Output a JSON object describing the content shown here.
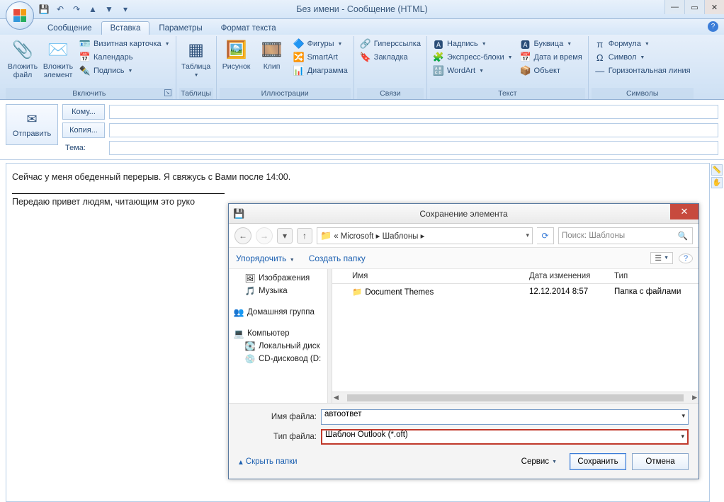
{
  "window": {
    "title": "Без имени - Сообщение (HTML)"
  },
  "qat": {
    "save": "💾",
    "undo": "↶",
    "redo": "↷",
    "prev": "▲",
    "next": "▼"
  },
  "tabs": {
    "message": "Сообщение",
    "insert": "Вставка",
    "options": "Параметры",
    "format": "Формат текста"
  },
  "ribbon": {
    "include": {
      "label": "Включить",
      "attach_file": "Вложить файл",
      "attach_item": "Вложить элемент",
      "bizcard": "Визитная карточка",
      "calendar": "Календарь",
      "signature": "Подпись"
    },
    "tables": {
      "label": "Таблицы",
      "table": "Таблица"
    },
    "illustrations": {
      "label": "Иллюстрации",
      "picture": "Рисунок",
      "clip": "Клип",
      "shapes": "Фигуры",
      "smartart": "SmartArt",
      "chart": "Диаграмма"
    },
    "links": {
      "label": "Связи",
      "hyperlink": "Гиперссылка",
      "bookmark": "Закладка"
    },
    "text": {
      "label": "Текст",
      "textbox": "Надпись",
      "quickparts": "Экспресс-блоки",
      "wordart": "WordArt",
      "dropcap": "Буквица",
      "datetime": "Дата и время",
      "object": "Объект"
    },
    "symbols": {
      "label": "Символы",
      "equation": "Формула",
      "symbol": "Символ",
      "hline": "Горизонтальная линия"
    }
  },
  "compose": {
    "send": "Отправить",
    "to": "Кому...",
    "cc": "Копия...",
    "subject_label": "Тема:",
    "subject_value": ""
  },
  "body": {
    "line1": "Сейчас у меня обеденный перерыв. Я свяжусь с Вами после 14:00.",
    "line2": "Передаю привет людям, читающим это руко"
  },
  "dialog": {
    "title": "Сохранение элемента",
    "breadcrumb_prefix": "«  Microsoft  ▸  Шаблоны  ▸",
    "search_placeholder": "Поиск: Шаблоны",
    "organize": "Упорядочить",
    "newfolder": "Создать папку",
    "cols": {
      "name": "Имя",
      "date": "Дата изменения",
      "type": "Тип"
    },
    "tree": {
      "pictures": "Изображения",
      "music": "Музыка",
      "homegroup": "Домашняя группа",
      "computer": "Компьютер",
      "localdisk": "Локальный диск",
      "cddrive": "CD-дисковод (D:"
    },
    "rows": [
      {
        "name": "Document Themes",
        "date": "12.12.2014 8:57",
        "type": "Папка с файлами"
      }
    ],
    "filename_label": "Имя файла:",
    "filename_value": "автоответ",
    "filetype_label": "Тип файла:",
    "filetype_value": "Шаблон Outlook (*.oft)",
    "hide_folders": "Скрыть папки",
    "service": "Сервис",
    "save": "Сохранить",
    "cancel": "Отмена"
  }
}
